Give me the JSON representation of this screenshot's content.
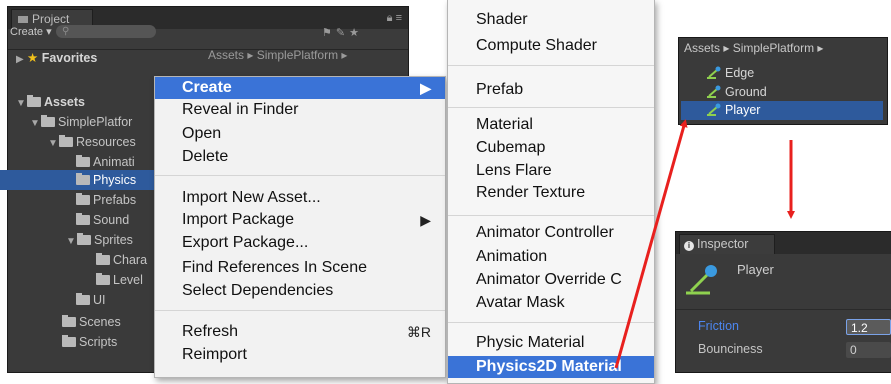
{
  "project_panel": {
    "tab_label": "Project",
    "create_label": "Create ▾",
    "breadcrumb": "Assets ▸ SimplePlatform ▸",
    "favorites_label": "Favorites",
    "tree": [
      {
        "label": "Assets"
      },
      {
        "label": "SimplePlatfor"
      },
      {
        "label": "Resources"
      },
      {
        "label": "Animati"
      },
      {
        "label": "Physics"
      },
      {
        "label": "Prefabs"
      },
      {
        "label": "Sound"
      },
      {
        "label": "Sprites"
      },
      {
        "label": "Chara"
      },
      {
        "label": "Level"
      },
      {
        "label": "UI"
      },
      {
        "label": "Scenes"
      },
      {
        "label": "Scripts"
      }
    ]
  },
  "context_menu": {
    "items": [
      {
        "label": "Create",
        "submenu": "▶"
      },
      {
        "label": "Reveal in Finder"
      },
      {
        "label": "Open"
      },
      {
        "label": "Delete"
      },
      {
        "label": "Import New Asset..."
      },
      {
        "label": "Import Package",
        "submenu": "▶"
      },
      {
        "label": "Export Package..."
      },
      {
        "label": "Find References In Scene"
      },
      {
        "label": "Select Dependencies"
      },
      {
        "label": "Refresh",
        "shortcut": "⌘R"
      },
      {
        "label": "Reimport"
      }
    ]
  },
  "create_submenu": {
    "items": [
      {
        "label": "Shader"
      },
      {
        "label": "Compute Shader"
      },
      {
        "label": "Prefab"
      },
      {
        "label": "Material"
      },
      {
        "label": "Cubemap"
      },
      {
        "label": "Lens Flare"
      },
      {
        "label": "Render Texture"
      },
      {
        "label": "Animator Controller"
      },
      {
        "label": "Animation"
      },
      {
        "label": "Animator Override C"
      },
      {
        "label": "Avatar Mask"
      },
      {
        "label": "Physic Material"
      },
      {
        "label": "Physics2D Material"
      }
    ]
  },
  "assets_callout": {
    "path": "Assets ▸ SimplePlatform ▸",
    "items": [
      {
        "label": "Edge"
      },
      {
        "label": "Ground"
      },
      {
        "label": "Player"
      }
    ]
  },
  "inspector": {
    "tab_label": "Inspector",
    "object_name": "Player",
    "properties": [
      {
        "label": "Friction",
        "value": "1.2"
      },
      {
        "label": "Bounciness",
        "value": "0"
      }
    ]
  },
  "colors": {
    "selection": "#2e5a9c",
    "menu_highlight": "#3a73d7",
    "arrow": "#e8201e",
    "friction_label": "#4c86f0"
  },
  "icons": [
    "folder-icon",
    "star-icon",
    "lock-icon",
    "search-icon",
    "physics-material-icon",
    "info-icon"
  ]
}
